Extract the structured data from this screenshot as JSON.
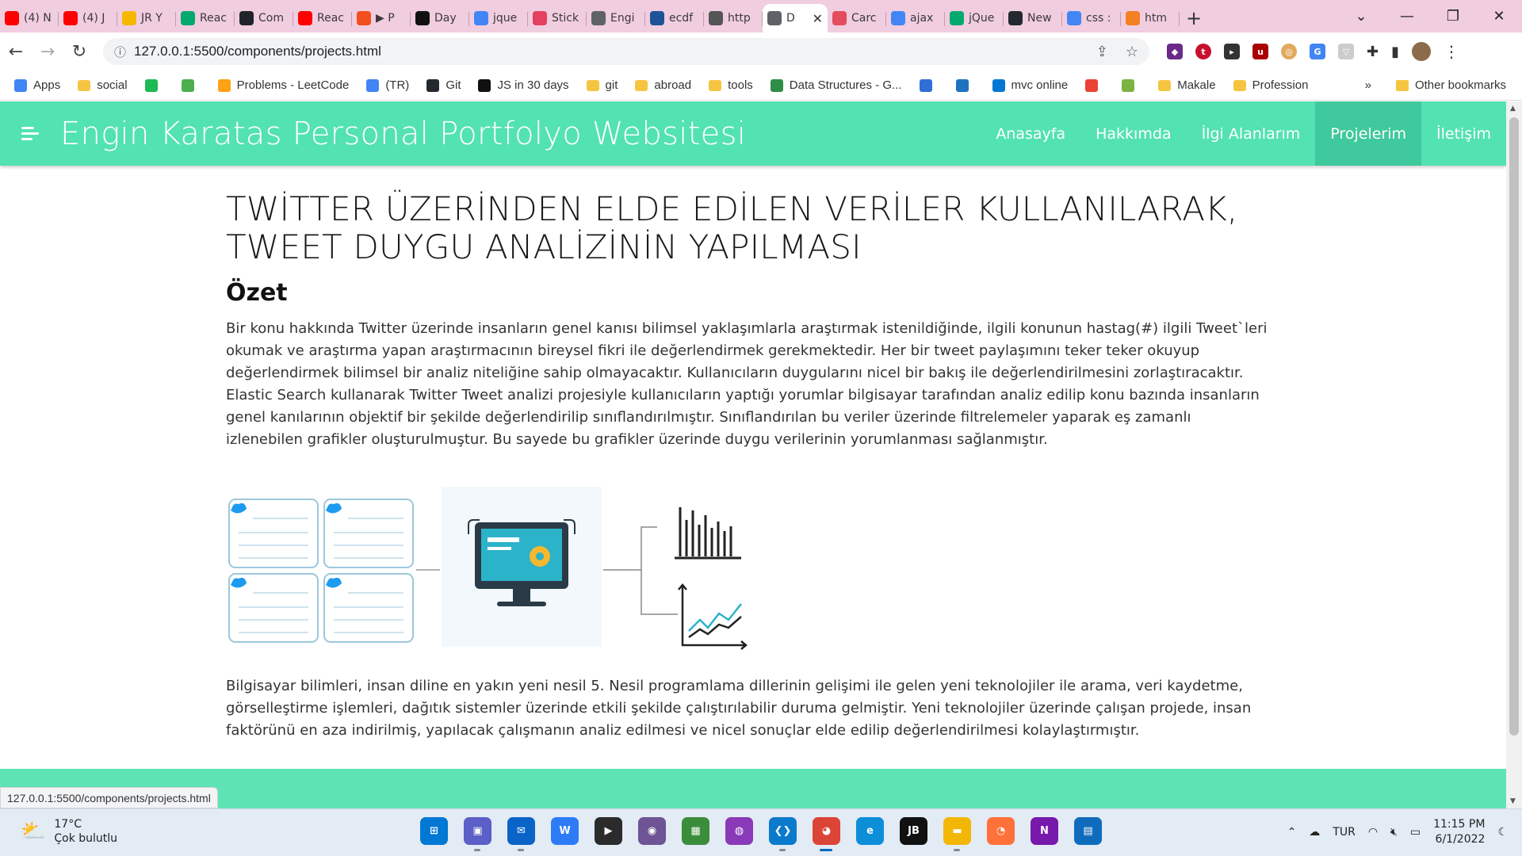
{
  "browser": {
    "tabs": [
      {
        "label": "(4) N",
        "icon": "youtube-icon",
        "color": "#ff0000"
      },
      {
        "label": "(4) J",
        "icon": "youtube-icon",
        "color": "#ff0000"
      },
      {
        "label": "JR Y",
        "icon": "k-icon",
        "color": "#f6b700"
      },
      {
        "label": "Reac",
        "icon": "w3schools-icon",
        "color": "#04aa6d"
      },
      {
        "label": "Com",
        "icon": "react-icon",
        "color": "#20232a"
      },
      {
        "label": "Reac",
        "icon": "youtube-icon",
        "color": "#ff0000"
      },
      {
        "label": "▶ P",
        "icon": "figma-icon",
        "color": "#f24e1e"
      },
      {
        "label": "Day",
        "icon": "hackernoon-icon",
        "color": "#111111"
      },
      {
        "label": "jque",
        "icon": "google-icon",
        "color": "#4285f4"
      },
      {
        "label": "Stick",
        "icon": "asterisk-icon",
        "color": "#e4405f"
      },
      {
        "label": "Engi",
        "icon": "globe-icon",
        "color": "#5f6368"
      },
      {
        "label": "ecdf",
        "icon": "stackexchange-icon",
        "color": "#1e5397"
      },
      {
        "label": "http",
        "icon": "robot-icon",
        "color": "#555555"
      },
      {
        "label": "D",
        "icon": "globe-icon",
        "color": "#5f6368",
        "active": true
      },
      {
        "label": "Carc",
        "icon": "codepen-icon",
        "color": "#e44d5c"
      },
      {
        "label": "ajax",
        "icon": "google-icon",
        "color": "#4285f4"
      },
      {
        "label": "jQue",
        "icon": "w3schools-icon",
        "color": "#04aa6d"
      },
      {
        "label": "New",
        "icon": "github-icon",
        "color": "#24292f"
      },
      {
        "label": "css :",
        "icon": "google-icon",
        "color": "#4285f4"
      },
      {
        "label": "htm",
        "icon": "stackoverflow-icon",
        "color": "#f48024"
      }
    ],
    "new_tab": "+",
    "url": "127.0.0.1:5500/components/projects.html",
    "status_url": "127.0.0.1:5500/components/projects.html",
    "bookmarks": [
      {
        "label": "Apps",
        "icon": "apps-grid-icon",
        "color": "#4285f4"
      },
      {
        "label": "social",
        "icon": "folder-icon",
        "color": "#f5c542"
      },
      {
        "label": "",
        "icon": "spotify-icon",
        "color": "#1db954"
      },
      {
        "label": "",
        "icon": "leaf-icon",
        "color": "#4caf50"
      },
      {
        "label": "Problems - LeetCode",
        "icon": "leetcode-icon",
        "color": "#ffa116"
      },
      {
        "label": "(TR)",
        "icon": "translate-icon",
        "color": "#4285f4"
      },
      {
        "label": "Git",
        "icon": "github-icon",
        "color": "#24292f"
      },
      {
        "label": "JS in 30 days",
        "icon": "js30-icon",
        "color": "#111111"
      },
      {
        "label": "git",
        "icon": "folder-icon",
        "color": "#f5c542"
      },
      {
        "label": "abroad",
        "icon": "folder-icon",
        "color": "#f5c542"
      },
      {
        "label": "tools",
        "icon": "folder-icon",
        "color": "#f5c542"
      },
      {
        "label": "Data Structures - G...",
        "icon": "geeksforgeeks-icon",
        "color": "#2f8d46"
      },
      {
        "label": "",
        "icon": "xmind-icon",
        "color": "#2f6fd6"
      },
      {
        "label": "",
        "icon": "html5-icon",
        "color": "#1e73be"
      },
      {
        "label": "mvc online",
        "icon": "cloud-icon",
        "color": "#0078d4"
      },
      {
        "label": "",
        "icon": "gmail-icon",
        "color": "#ea4335"
      },
      {
        "label": "",
        "icon": "bar-icon",
        "color": "#7cb342"
      },
      {
        "label": "Makale",
        "icon": "folder-icon",
        "color": "#f5c542"
      },
      {
        "label": "Profession",
        "icon": "folder-icon",
        "color": "#f5c542"
      }
    ],
    "bookmarks_more": "»",
    "other_bookmarks": "Other bookmarks"
  },
  "site": {
    "title": "Engin Karatas Personal Portfolyo Websitesi",
    "nav": [
      {
        "label": "Anasayfa"
      },
      {
        "label": "Hakkımda"
      },
      {
        "label": "İlgi Alanlarım"
      },
      {
        "label": "Projelerim",
        "active": true
      },
      {
        "label": "İletişim"
      }
    ]
  },
  "project": {
    "title": "TWİTTER ÜZERİNDEN ELDE EDİLEN VERİLER KULLANILARAK, TWEET DUYGU ANALİZİNİN YAPILMASI",
    "summary_heading": "Özet",
    "summary": "Bir konu hakkında Twitter üzerinde insanların genel kanısı bilimsel yaklaşımlarla araştırmak istenildiğinde, ilgili konunun hastag(#) ilgili Tweet`leri okumak ve araştırma yapan araştırmacının bireysel fikri ile değerlendirmek gerekmektedir. Her bir tweet paylaşımını teker teker okuyup değerlendirmek bilimsel bir analiz niteliğine sahip olmayacaktır. Kullanıcıların duygularını nicel bir bakış ile değerlendirilmesini zorlaştıracaktır. Elastic Search kullanarak Twitter Tweet analizi projesiyle kullanıcıların yaptığı yorumlar bilgisayar tarafından analiz edilip konu bazında insanların genel kanılarının objektif bir şekilde değerlendirilip sınıflandırılmıştır. Sınıflandırılan bu veriler üzerinde filtrelemeler yaparak eş zamanlı izlenebilen grafikler oluşturulmuştur. Bu sayede bu grafikler üzerinde duygu verilerinin yorumlanması sağlanmıştır.",
    "body": "Bilgisayar bilimleri, insan diline en yakın yeni nesil 5. Nesil programlama dillerinin gelişimi ile gelen yeni teknolojiler ile arama, veri kaydetme, görselleştirme işlemleri, dağıtık sistemler üzerinde etkili şekilde çalıştırılabilir duruma gelmiştir. Yeni teknolojiler üzerinde çalışan projede, insan faktörünü en aza indirilmiş, yapılacak çalışmanın analiz edilmesi ve nicel sonuçlar elde edilip değerlendirilmesi kolaylaştırmıştır."
  },
  "taskbar": {
    "weather_temp": "17°C",
    "weather_desc": "Çok bulutlu",
    "apps": [
      {
        "icon": "windows-start-icon",
        "color": "#0078d4"
      },
      {
        "icon": "teams-chat-icon",
        "color": "#5b5fc7"
      },
      {
        "icon": "mail-icon",
        "color": "#0a64c8"
      },
      {
        "icon": "wps-icon",
        "color": "#2d7cf6"
      },
      {
        "icon": "media-player-icon",
        "color": "#2b2b2b"
      },
      {
        "icon": "github-desktop-icon",
        "color": "#6e5494"
      },
      {
        "icon": "spreadsheet-icon",
        "color": "#3b8d3b"
      },
      {
        "icon": "github-icon",
        "color": "#8a3ab9"
      },
      {
        "icon": "vscode-icon",
        "color": "#0a7acc"
      },
      {
        "icon": "chrome-icon",
        "color": "#db4437"
      },
      {
        "icon": "edge-icon",
        "color": "#0c8ed9"
      },
      {
        "icon": "jetbrains-icon",
        "color": "#111111"
      },
      {
        "icon": "file-explorer-icon",
        "color": "#f2b705"
      },
      {
        "icon": "firefox-icon",
        "color": "#ff7139"
      },
      {
        "icon": "onenote-icon",
        "color": "#7719aa"
      },
      {
        "icon": "calendar-icon",
        "color": "#0f6cbd"
      }
    ],
    "language": "TUR",
    "time": "11:15 PM",
    "date": "6/1/2022"
  },
  "colors": {
    "nav_bg": "#53e2b1",
    "nav_active": "#3fc99c",
    "tab_strip": "#f1cde0",
    "footer_band": "#5ee3b5"
  }
}
